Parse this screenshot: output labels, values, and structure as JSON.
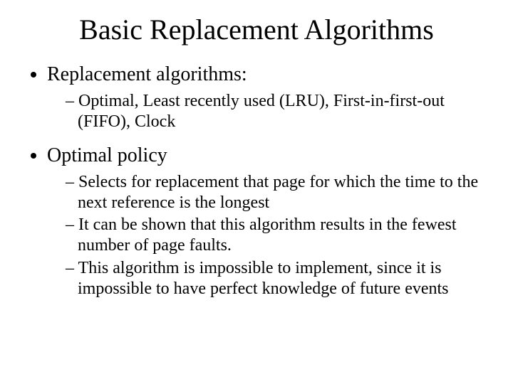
{
  "title": "Basic Replacement Algorithms",
  "bullets": [
    {
      "text": "Replacement algorithms:",
      "sub": [
        "Optimal, Least recently used (LRU), First-in-first-out (FIFO), Clock"
      ]
    },
    {
      "text": "Optimal policy",
      "sub": [
        "Selects for replacement that page for which the time to the next reference is the longest",
        "It can be shown that this algorithm results in the fewest number of page faults.",
        "This algorithm is impossible to implement, since it is impossible to have perfect knowledge of future events"
      ]
    }
  ]
}
